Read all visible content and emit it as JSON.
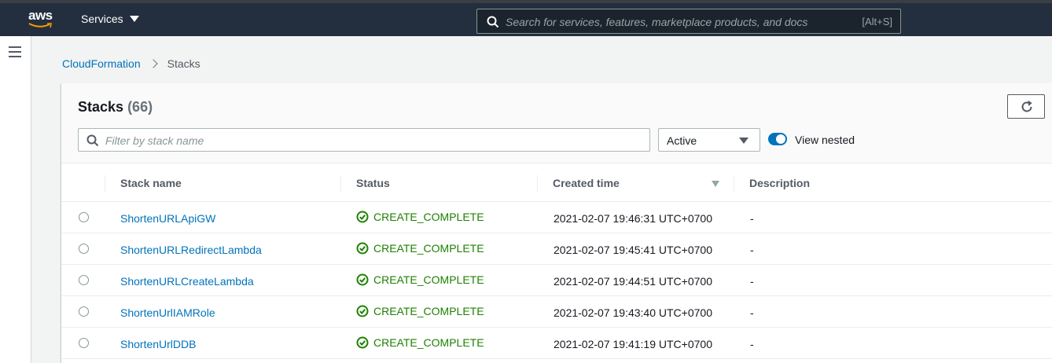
{
  "topbar": {
    "logo_text": "aws",
    "services_label": "Services",
    "search_placeholder": "Search for services, features, marketplace products, and docs",
    "search_shortcut": "[Alt+S]"
  },
  "breadcrumb": {
    "parent": "CloudFormation",
    "current": "Stacks"
  },
  "panel": {
    "title": "Stacks",
    "count": "(66)",
    "filter_placeholder": "Filter by stack name",
    "status_filter": "Active",
    "view_nested_label": "View nested",
    "view_nested_on": true
  },
  "table": {
    "columns": [
      "Stack name",
      "Status",
      "Created time",
      "Description"
    ],
    "rows": [
      {
        "name": "ShortenURLApiGW",
        "status": "CREATE_COMPLETE",
        "created": "2021-02-07 19:46:31 UTC+0700",
        "description": "-"
      },
      {
        "name": "ShortenURLRedirectLambda",
        "status": "CREATE_COMPLETE",
        "created": "2021-02-07 19:45:41 UTC+0700",
        "description": "-"
      },
      {
        "name": "ShortenURLCreateLambda",
        "status": "CREATE_COMPLETE",
        "created": "2021-02-07 19:44:51 UTC+0700",
        "description": "-"
      },
      {
        "name": "ShortenUrlIAMRole",
        "status": "CREATE_COMPLETE",
        "created": "2021-02-07 19:43:40 UTC+0700",
        "description": "-"
      },
      {
        "name": "ShortenUrlDDB",
        "status": "CREATE_COMPLETE",
        "created": "2021-02-07 19:41:19 UTC+0700",
        "description": "-"
      }
    ]
  },
  "colors": {
    "nav_bg": "#232f3e",
    "link": "#0073bb",
    "success": "#1d8102",
    "toggle_on": "#0073bb"
  }
}
